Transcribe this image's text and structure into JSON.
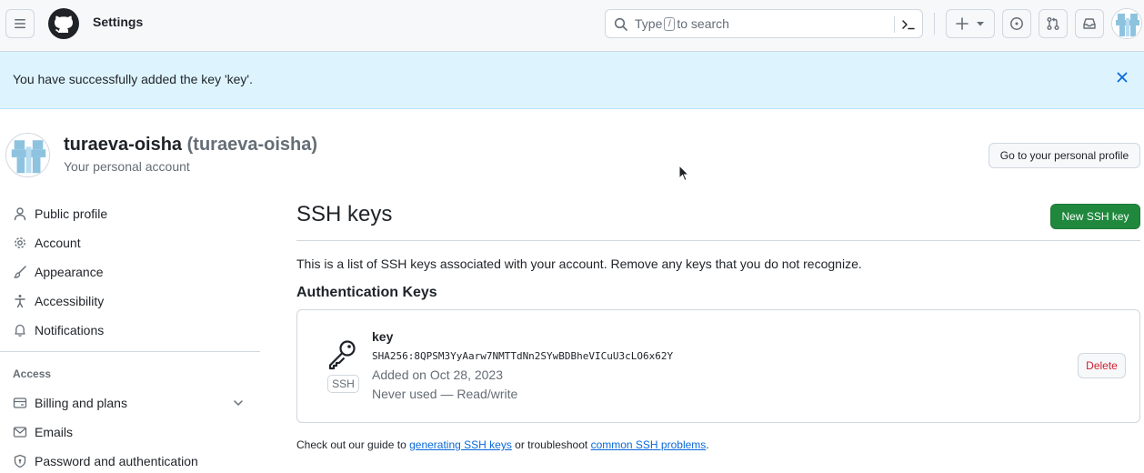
{
  "header": {
    "title": "Settings",
    "search": {
      "prefix": "Type",
      "key": "/",
      "suffix": "to search"
    },
    "icons": [
      "hamburger-icon",
      "github-logo",
      "search-icon",
      "command-palette-icon",
      "plus-icon",
      "issues-icon",
      "pull-requests-icon",
      "inbox-icon"
    ]
  },
  "flash": {
    "message": "You have successfully added the key 'key'."
  },
  "profile": {
    "name": "turaeva-oisha",
    "login": "(turaeva-oisha)",
    "subtitle": "Your personal account",
    "button": "Go to your personal profile"
  },
  "sidebar": {
    "items": [
      {
        "label": "Public profile",
        "icon": "person-icon"
      },
      {
        "label": "Account",
        "icon": "gear-icon"
      },
      {
        "label": "Appearance",
        "icon": "paintbrush-icon"
      },
      {
        "label": "Accessibility",
        "icon": "accessibility-icon"
      },
      {
        "label": "Notifications",
        "icon": "bell-icon"
      }
    ],
    "group_label": "Access",
    "access_items": [
      {
        "label": "Billing and plans",
        "icon": "credit-card-icon"
      },
      {
        "label": "Emails",
        "icon": "mail-icon"
      },
      {
        "label": "Password and authentication",
        "icon": "shield-lock-icon"
      }
    ]
  },
  "main": {
    "title": "SSH keys",
    "new_button": "New SSH key",
    "description": "This is a list of SSH keys associated with your account. Remove any keys that you do not recognize.",
    "section_title": "Authentication Keys",
    "key": {
      "title": "key",
      "badge": "SSH",
      "fingerprint": "SHA256:8QPSM3YyAarw7NMTTdNn2SYwBDBheVICuU3cLO6x62Y",
      "added": "Added on Oct 28, 2023",
      "usage": "Never used — Read/write",
      "delete_label": "Delete"
    },
    "footer": {
      "prefix": "Check out our guide to",
      "link1": "generating SSH keys",
      "middle": "or troubleshoot",
      "link2": "common SSH problems",
      "suffix": "."
    }
  },
  "colors": {
    "primary_button": "#1f883d",
    "flash_bg": "#ddf4ff",
    "link": "#0969da",
    "danger": "#cf222e"
  }
}
